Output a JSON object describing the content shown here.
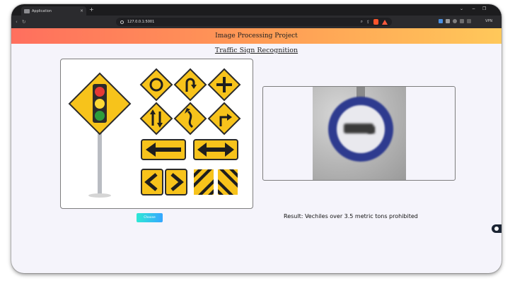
{
  "browser": {
    "tab_title": "Application",
    "tab_close": "×",
    "new_tab": "+",
    "url": "127.0.0.1:5001",
    "vpn_label": "VPN",
    "window_controls": [
      "⌄",
      "−",
      "❐"
    ]
  },
  "header": {
    "title": "Image Processing Project"
  },
  "main": {
    "subtitle": "Traffic Sign Recognition",
    "choose_button": "Choose",
    "result_text": "Result: Vechiles over 3.5 metric tons prohibited"
  },
  "colors": {
    "header_gradient": [
      "#ff6f5e",
      "#ff9a55",
      "#ffc85a"
    ],
    "button_gradient": [
      "#2ee8d5",
      "#35a6ff"
    ],
    "sign_yellow": "#f7c31b",
    "sign_ring": "#2e3b8f"
  },
  "icons": {
    "back": "back-icon",
    "reload": "reload-icon",
    "bookmark": "bookmark-icon",
    "site_info": "site-info-icon",
    "search": "search-icon",
    "share": "share-icon",
    "brave": "brave-shield-icon",
    "rewards": "brave-rewards-icon",
    "chat": "chat-icon"
  }
}
